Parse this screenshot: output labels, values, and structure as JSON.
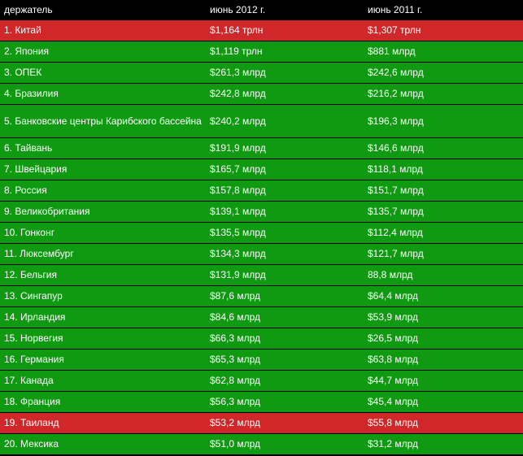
{
  "headers": [
    "держатель",
    "июнь 2012 г.",
    "июнь 2011 г."
  ],
  "colors": {
    "green": "#0f9a12",
    "red": "#d0282a",
    "header": "#000000"
  },
  "rows": [
    {
      "holder": "1. Китай",
      "y2012": "$1,164 трлн",
      "y2011": "$1,307 трлн",
      "highlight": "red"
    },
    {
      "holder": "2. Япония",
      "y2012": "$1,119 трлн",
      "y2011": "$881 млрд",
      "highlight": "green"
    },
    {
      "holder": "3. ОПЕК",
      "y2012": "$261,3 млрд",
      "y2011": "$242,6 млрд",
      "highlight": "green"
    },
    {
      "holder": "4. Бразилия",
      "y2012": "$242,8 млрд",
      "y2011": "$216,2 млрд",
      "highlight": "green"
    },
    {
      "holder": "5. Банковские центры Карибского бассейна",
      "y2012": "$240,2 млрд",
      "y2011": "$196,3 млрд",
      "highlight": "green"
    },
    {
      "holder": "6. Тайвань",
      "y2012": "$191,9 млрд",
      "y2011": "$146,6 млрд",
      "highlight": "green"
    },
    {
      "holder": "7. Швейцария",
      "y2012": "$165,7 млрд",
      "y2011": "$118,1 млрд",
      "highlight": "green"
    },
    {
      "holder": "8. Россия",
      "y2012": "$157,8 млрд",
      "y2011": "$151,7 млрд",
      "highlight": "green"
    },
    {
      "holder": "9. Великобритания",
      "y2012": "$139,1 млрд",
      "y2011": "$135,7 млрд",
      "highlight": "green"
    },
    {
      "holder": "10. Гонконг",
      "y2012": "$135,5 млрд",
      "y2011": "$112,4 млрд",
      "highlight": "green"
    },
    {
      "holder": "11. Люксембург",
      "y2012": "$134,3 млрд",
      "y2011": "$121,7 млрд",
      "highlight": "green"
    },
    {
      "holder": "12. Бельгия",
      "y2012": "$131,9 млрд",
      "y2011": "88,8 млрд",
      "highlight": "green"
    },
    {
      "holder": "13. Сингапур",
      "y2012": "$87,6 млрд",
      "y2011": "$64,4 млрд",
      "highlight": "green"
    },
    {
      "holder": "14. Ирландия",
      "y2012": "$84,6 млрд",
      "y2011": "$53,9 млрд",
      "highlight": "green"
    },
    {
      "holder": "15. Норвегия",
      "y2012": "$66,3 млрд",
      "y2011": "$26,5 млрд",
      "highlight": "green"
    },
    {
      "holder": "16. Германия",
      "y2012": "$65,3 млрд",
      "y2011": "$63,8 млрд",
      "highlight": "green"
    },
    {
      "holder": "17. Канада",
      "y2012": "$62,8 млрд",
      "y2011": "$44,7 млрд",
      "highlight": "green"
    },
    {
      "holder": "18. Франция",
      "y2012": "$56,3 млрд",
      "y2011": "$45,4 млрд",
      "highlight": "green"
    },
    {
      "holder": "19. Таиланд",
      "y2012": "$53,2 млрд",
      "y2011": "$55,8 млрд",
      "highlight": "red"
    },
    {
      "holder": "20. Мексика",
      "y2012": "$51,0 млрд",
      "y2011": "$31,2 млрд",
      "highlight": "green"
    }
  ]
}
